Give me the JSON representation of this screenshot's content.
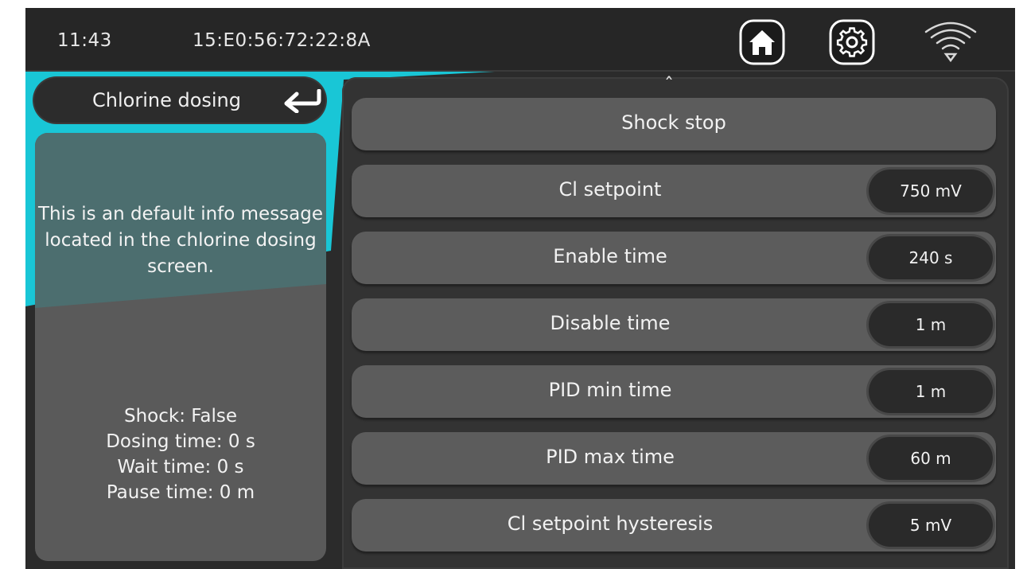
{
  "topbar": {
    "time": "11:43",
    "device_id": "15:E0:56:72:22:8A",
    "icons": [
      "home-icon",
      "gear-icon",
      "wifi-icon"
    ]
  },
  "colors": {
    "accent": "#19c6d6",
    "background": "#2b2b2b",
    "row": "#5c5c5c",
    "pill": "#2a2a2a"
  },
  "back": {
    "label": "Chlorine dosing",
    "icon": "return-arrow-icon"
  },
  "info": {
    "message": "This is an default info message located in the chlorine dosing screen.",
    "stats": [
      "Shock: False",
      "Dosing time: 0 s",
      "Wait time: 0 s",
      "Pause time: 0 m"
    ]
  },
  "list": {
    "scroll_up_icon": "chevron-up-icon",
    "rows": [
      {
        "label": "Shock stop",
        "value": ""
      },
      {
        "label": "Cl setpoint",
        "value": "750 mV"
      },
      {
        "label": "Enable time",
        "value": "240 s"
      },
      {
        "label": "Disable time",
        "value": "1 m"
      },
      {
        "label": "PID min time",
        "value": "1 m"
      },
      {
        "label": "PID max time",
        "value": "60 m"
      },
      {
        "label": "Cl setpoint hysteresis",
        "value": "5 mV"
      }
    ]
  }
}
